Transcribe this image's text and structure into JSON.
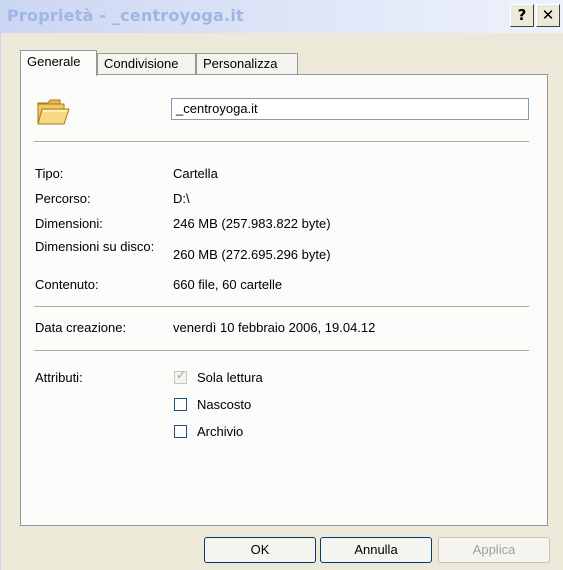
{
  "window": {
    "title": "Proprietà - _centroyoga.it",
    "help_label": "?",
    "close_label": "✕"
  },
  "tabs": [
    {
      "label": "Generale",
      "active": true
    },
    {
      "label": "Condivisione",
      "active": false
    },
    {
      "label": "Personalizza",
      "active": false
    }
  ],
  "general": {
    "folder_icon": "folder-icon",
    "name_value": "_centroyoga.it",
    "rows": [
      {
        "label": "Tipo:",
        "value": "Cartella"
      },
      {
        "label": "Percorso:",
        "value": "D:\\"
      },
      {
        "label": "Dimensioni:",
        "value": "246 MB (257.983.822 byte)"
      },
      {
        "label": "Dimensioni su disco:",
        "value": "260 MB (272.695.296 byte)"
      },
      {
        "label": "Contenuto:",
        "value": "660 file, 60 cartelle"
      }
    ],
    "created": {
      "label": "Data creazione:",
      "value": "venerdì 10 febbraio 2006, 19.04.12"
    },
    "attributes": {
      "label": "Attributi:",
      "items": [
        {
          "label": "Sola lettura",
          "checked": true,
          "enabled": false
        },
        {
          "label": "Nascosto",
          "checked": false,
          "enabled": true
        },
        {
          "label": "Archivio",
          "checked": false,
          "enabled": true
        }
      ]
    }
  },
  "buttons": {
    "ok": "OK",
    "cancel": "Annulla",
    "apply": "Applica"
  }
}
